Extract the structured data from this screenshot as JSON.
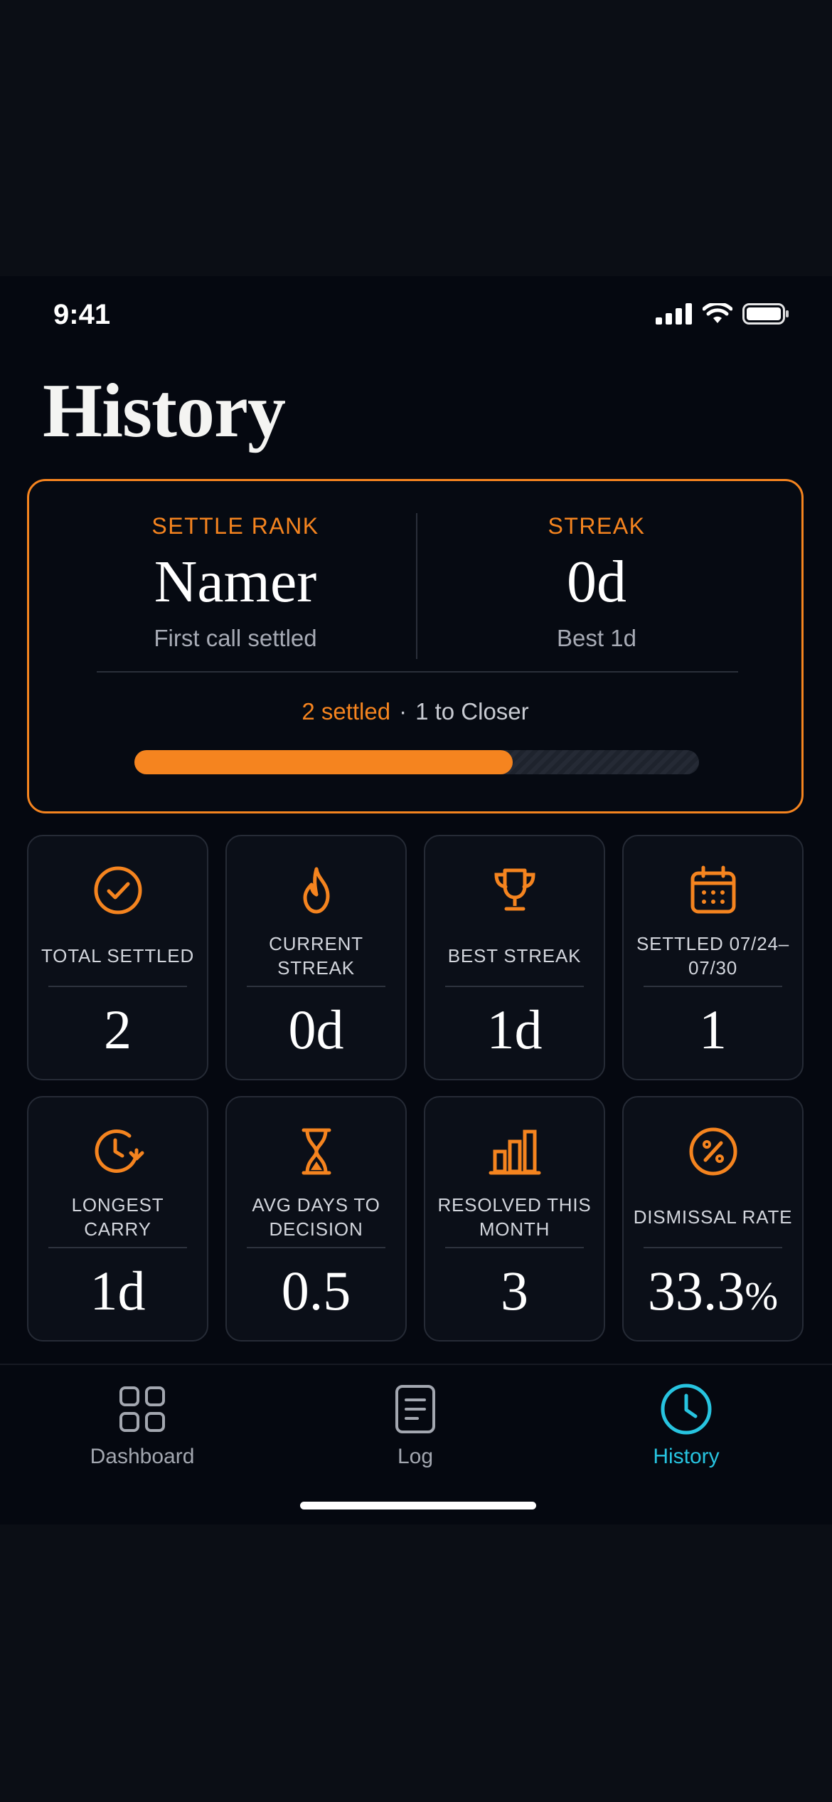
{
  "status_bar": {
    "time": "9:41"
  },
  "page": {
    "title": "History"
  },
  "rank_card": {
    "rank_label": "SETTLE RANK",
    "rank_value": "Namer",
    "rank_sub": "First call settled",
    "streak_label": "STREAK",
    "streak_value": "0d",
    "streak_sub": "Best 1d",
    "progress_settled": "2 settled",
    "progress_separator": "·",
    "progress_next": "1 to Closer",
    "progress_fraction": 0.67
  },
  "stats": [
    {
      "icon": "check-circle-icon",
      "label": "TOTAL SETTLED",
      "value": "2",
      "unit": ""
    },
    {
      "icon": "flame-icon",
      "label": "CURRENT STREAK",
      "value": "0d",
      "unit": ""
    },
    {
      "icon": "trophy-icon",
      "label": "BEST STREAK",
      "value": "1d",
      "unit": ""
    },
    {
      "icon": "calendar-icon",
      "label": "SETTLED 07/24–07/30",
      "value": "1",
      "unit": ""
    },
    {
      "icon": "clock-arrow-icon",
      "label": "LONGEST CARRY",
      "value": "1d",
      "unit": ""
    },
    {
      "icon": "hourglass-icon",
      "label": "AVG DAYS TO DECISION",
      "value": "0.5",
      "unit": ""
    },
    {
      "icon": "bar-chart-icon",
      "label": "RESOLVED THIS MONTH",
      "value": "3",
      "unit": ""
    },
    {
      "icon": "percent-circle-icon",
      "label": "DISMISSAL RATE",
      "value": "33.3",
      "unit": "%"
    }
  ],
  "tab_bar": {
    "tabs": [
      {
        "label": "Dashboard",
        "icon": "grid-icon",
        "active": false
      },
      {
        "label": "Log",
        "icon": "document-icon",
        "active": false
      },
      {
        "label": "History",
        "icon": "clock-icon",
        "active": true
      }
    ]
  },
  "colors": {
    "accent": "#f5841f",
    "active_tab": "#27c4e0",
    "background": "#050810"
  }
}
